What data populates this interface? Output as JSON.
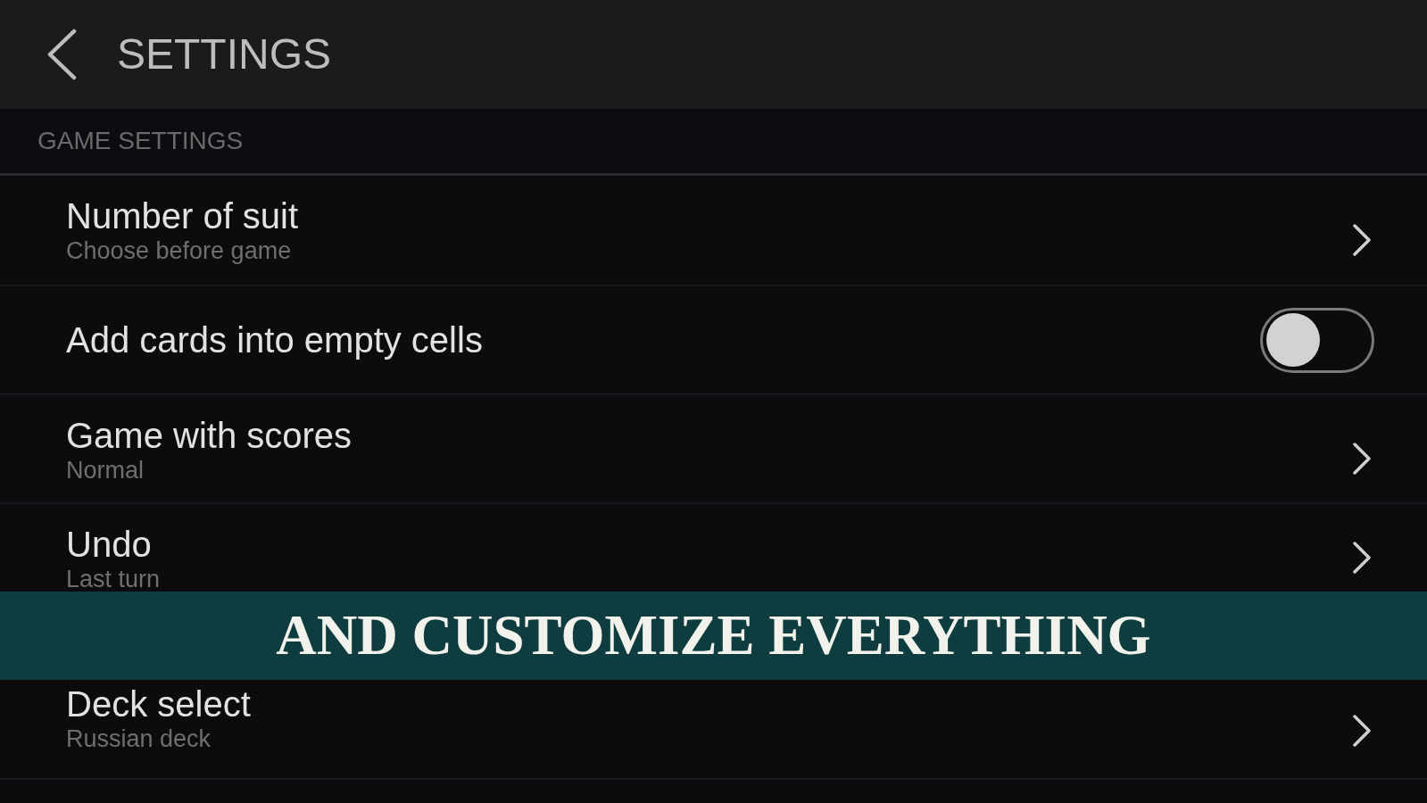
{
  "header": {
    "title": "SETTINGS"
  },
  "section": {
    "title": "GAME SETTINGS"
  },
  "rows": [
    {
      "kind": "link",
      "title": "Number of suit",
      "subtitle": "Choose before game"
    },
    {
      "kind": "toggle",
      "title": "Add cards into empty cells",
      "on": false
    },
    {
      "kind": "link",
      "title": "Game with scores",
      "subtitle": "Normal"
    },
    {
      "kind": "link",
      "title": "Undo",
      "subtitle": "Last turn"
    }
  ],
  "banner": {
    "text": "AND CUSTOMIZE EVERYTHING"
  },
  "more_rows": [
    {
      "kind": "link",
      "title": "Deck select",
      "subtitle": "Russian deck"
    }
  ]
}
